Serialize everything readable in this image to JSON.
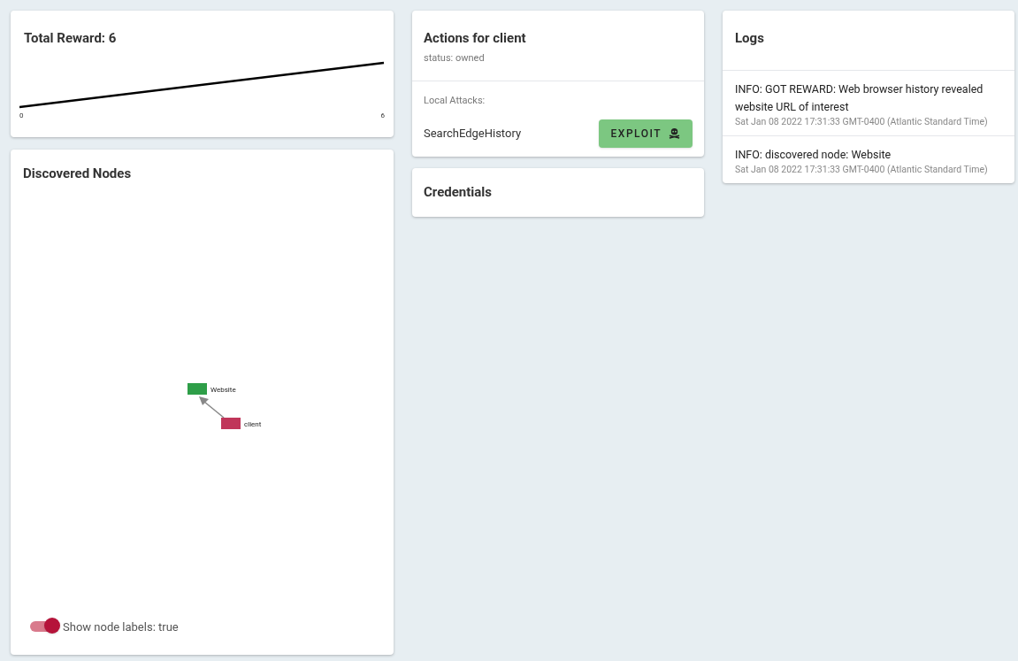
{
  "reward": {
    "title": "Total Reward: 6",
    "x_axis_labels": [
      "0",
      "6"
    ]
  },
  "graph": {
    "title": "Discovered Nodes",
    "nodes": [
      {
        "label": "Website",
        "color": "#2e9e48"
      },
      {
        "label": "client",
        "color": "#c0365a"
      }
    ],
    "toggle": {
      "label": "Show node labels: true",
      "on": true
    }
  },
  "actions": {
    "title": "Actions for client",
    "status": "status: owned",
    "section": "Local Attacks:",
    "attacks": [
      {
        "name": "SearchEdgeHistory",
        "button": "EXPLOIT"
      }
    ]
  },
  "credentials": {
    "title": "Credentials"
  },
  "logs": {
    "title": "Logs",
    "entries": [
      {
        "message": "INFO: GOT REWARD: Web browser history revealed website URL of interest",
        "time": "Sat Jan 08 2022 17:31:33 GMT-0400 (Atlantic Standard Time)"
      },
      {
        "message": "INFO: discovered node: Website",
        "time": "Sat Jan 08 2022 17:31:33 GMT-0400 (Atlantic Standard Time)"
      }
    ]
  }
}
